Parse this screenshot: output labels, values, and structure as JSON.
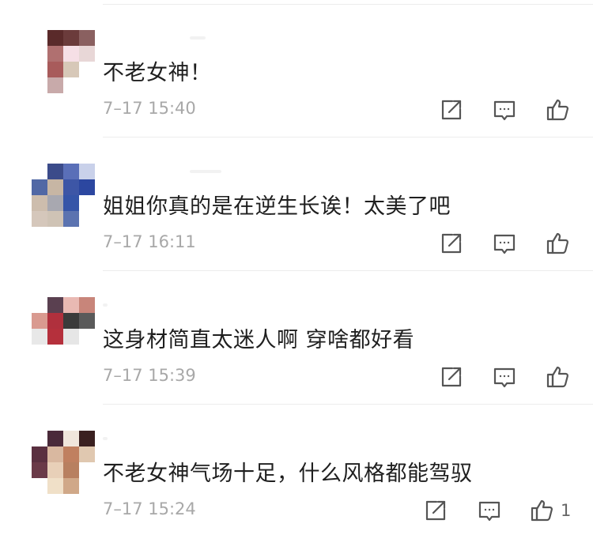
{
  "comments": [
    {
      "text": "不老女神！",
      "time": "7–17 15:40",
      "like_count": "",
      "avatar": [
        "#ffffff",
        "#5a2a2a",
        "#6b3b3b",
        "#8a6060",
        "#ffffff",
        "#b07070",
        "#f6dfe6",
        "#e8d7d7",
        "#ffffff",
        "#a85b5b",
        "#d7c8b8",
        "#ffffff",
        "#ffffff",
        "#c8aaaa",
        "#ffffff",
        "#ffffff"
      ]
    },
    {
      "text": "姐姐你真的是在逆生长诶！太美了吧",
      "time": "7–17 16:11",
      "like_count": "",
      "avatar": [
        "#ffffff",
        "#3b4b8a",
        "#5a6fb8",
        "#c9d1ea",
        "#5168a5",
        "#c7b6a4",
        "#3d56a6",
        "#2c47a0",
        "#cdbdad",
        "#a8a8b0",
        "#3555a8",
        "#ffffff",
        "#d5c7bb",
        "#cfc3b5",
        "#5b73b0",
        "#ffffff"
      ]
    },
    {
      "text": "这身材简直太迷人啊 穿啥都好看",
      "time": "7–17 15:39",
      "like_count": "",
      "avatar": [
        "#ffffff",
        "#5a4050",
        "#e9b9b3",
        "#c8857a",
        "#d99a90",
        "#b0303d",
        "#3b3b3b",
        "#5a5a5a",
        "#e8e8e8",
        "#b5303c",
        "#e6e6e6",
        "#ffffff",
        "#ffffff",
        "#ffffff",
        "#ffffff",
        "#ffffff"
      ]
    },
    {
      "text": "不老女神气场十足，什么风格都能驾驭",
      "time": "7–17 15:24",
      "like_count": "1",
      "avatar": [
        "#ffffff",
        "#4a2a3a",
        "#f0e6dc",
        "#3a2020",
        "#5a3040",
        "#d9b8a0",
        "#c08060",
        "#e0c8b0",
        "#6a3a48",
        "#e8d0b8",
        "#b88060",
        "#ffffff",
        "#ffffff",
        "#f0e0c8",
        "#d0a888",
        "#ffffff"
      ]
    }
  ],
  "icons": {
    "share": "share-icon",
    "reply": "reply-icon",
    "like": "thumbs-up-icon"
  },
  "colors": {
    "text": "#1f1f1f",
    "time": "#a8a8a8",
    "icon": "#555555"
  }
}
